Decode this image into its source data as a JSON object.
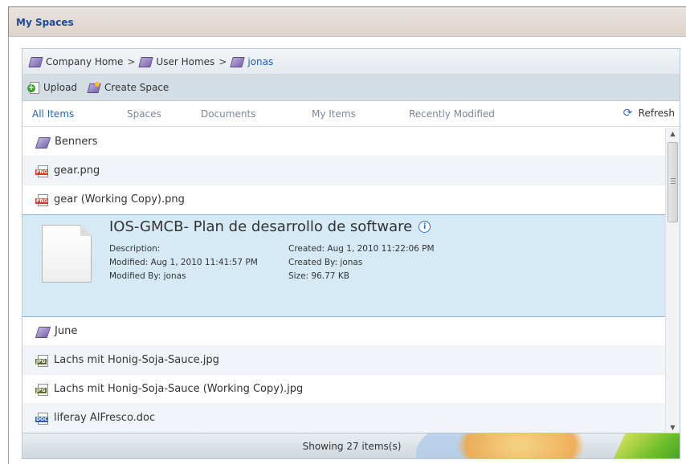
{
  "portlet": {
    "title": "My Spaces"
  },
  "breadcrumb": [
    {
      "label": "Company Home"
    },
    {
      "label": "User Homes"
    },
    {
      "label": "jonas"
    }
  ],
  "breadcrumb_separator": ">",
  "toolbar": {
    "upload_label": "Upload",
    "create_space_label": "Create Space"
  },
  "tabs": [
    {
      "label": "All Items",
      "active": true
    },
    {
      "label": "Spaces"
    },
    {
      "label": "Documents"
    },
    {
      "label": "My Items"
    },
    {
      "label": "Recently Modified"
    }
  ],
  "refresh_label": "Refresh",
  "items": [
    {
      "type": "space",
      "name": "Benners"
    },
    {
      "type": "png",
      "name": "gear.png"
    },
    {
      "type": "png",
      "name": "gear (Working Copy).png"
    },
    {
      "type": "document",
      "selected": true,
      "name": "IOS-GMCB- Plan de desarrollo de software",
      "description": "Description:",
      "modified": "Modified: Aug 1, 2010 11:41:57 PM",
      "modified_by": "Modified By: jonas",
      "created": "Created: Aug 1, 2010 11:22:06 PM",
      "created_by": "Created By: jonas",
      "size": "Size: 96.77 KB"
    },
    {
      "type": "space",
      "name": "June"
    },
    {
      "type": "jpg",
      "name": "Lachs mit Honig-Soja-Sauce.jpg"
    },
    {
      "type": "jpg",
      "name": "Lachs mit Honig-Soja-Sauce (Working Copy).jpg"
    },
    {
      "type": "doc",
      "name": "liferay AlFresco.doc"
    }
  ],
  "file_tags": {
    "png": "PNG",
    "jpg": "JPG",
    "doc": "DOC"
  },
  "footer": {
    "status": "Showing 27 items(s)"
  }
}
